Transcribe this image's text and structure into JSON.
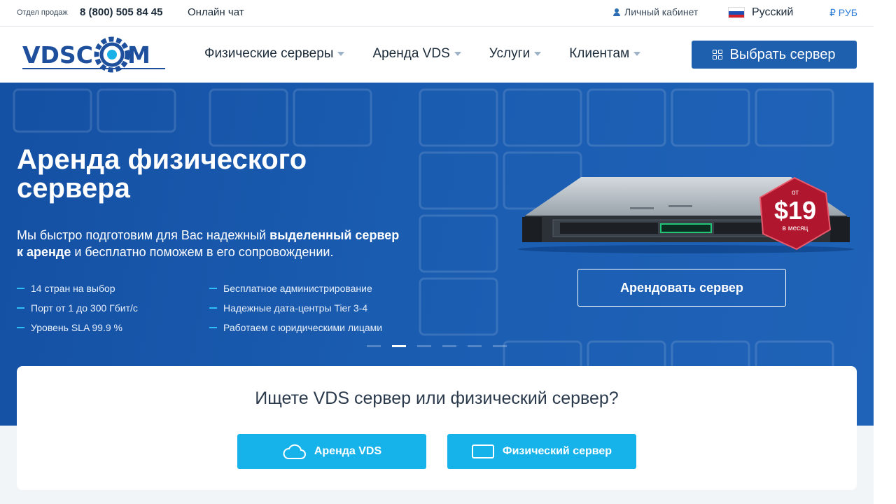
{
  "topbar": {
    "sales_label": "Отдел продаж",
    "phone": "8 (800) 505 84 45",
    "chat": "Онлайн чат",
    "cabinet": "Личный кабинет",
    "language": "Русский",
    "currency": "₽ РУБ"
  },
  "header": {
    "logo_text": "VDSCOM",
    "nav": [
      {
        "label": "Физические серверы"
      },
      {
        "label": "Аренда VDS"
      },
      {
        "label": "Услуги"
      },
      {
        "label": "Клиентам"
      }
    ],
    "choose_button": "Выбрать сервер"
  },
  "hero": {
    "title": "Аренда физического сервера",
    "lead_part1": "Мы быстро подготовим для Вас надежный ",
    "lead_bold": "выделенный сервер к аренде",
    "lead_part2": " и бесплатно поможем в его сопровождении.",
    "features_col1": [
      "14 стран на выбор",
      "Порт от 1 до 300 Гбит/с",
      "Уровень SLA 99.9 %"
    ],
    "features_col2": [
      "Бесплатное администрирование",
      "Надежные дата-центры Tier 3-4",
      "Работаем с юридическими лицами"
    ],
    "slides_total": 6,
    "slide_active_index": 1,
    "price_prefix": "от",
    "price": "$19",
    "price_suffix": "в месяц",
    "rent_button": "Арендовать сервер"
  },
  "search": {
    "question": "Ищете VDS сервер или физический сервер?",
    "vds_button": "Аренда VDS",
    "physical_button": "Физический сервер"
  },
  "colors": {
    "brand_blue": "#1e5fae",
    "hero_blue": "#1a5cb0",
    "accent_cyan": "#16b3ea",
    "badge_red": "#b0172e"
  }
}
